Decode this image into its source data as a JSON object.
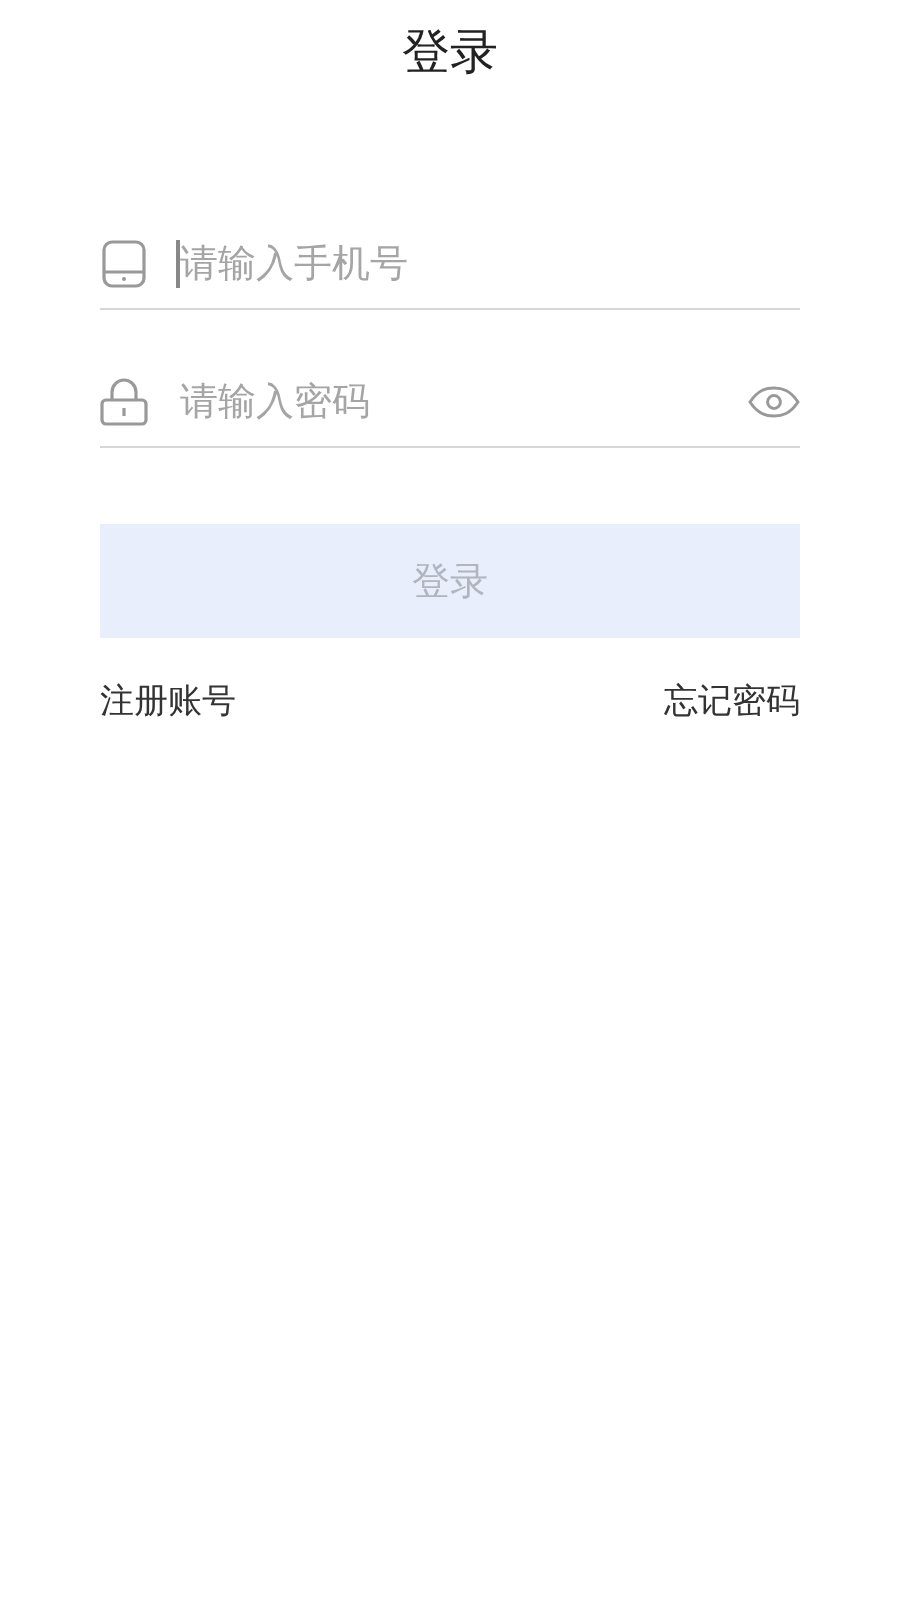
{
  "header": {
    "title": "登录"
  },
  "fields": [
    {
      "kind": "phone",
      "placeholder": "请输入手机号",
      "focused": true
    },
    {
      "kind": "password",
      "placeholder": "请输入密码",
      "focused": false
    }
  ],
  "login_button": {
    "label": "登录",
    "disabled": true
  },
  "links": [
    "注册账号",
    "忘记密码"
  ]
}
